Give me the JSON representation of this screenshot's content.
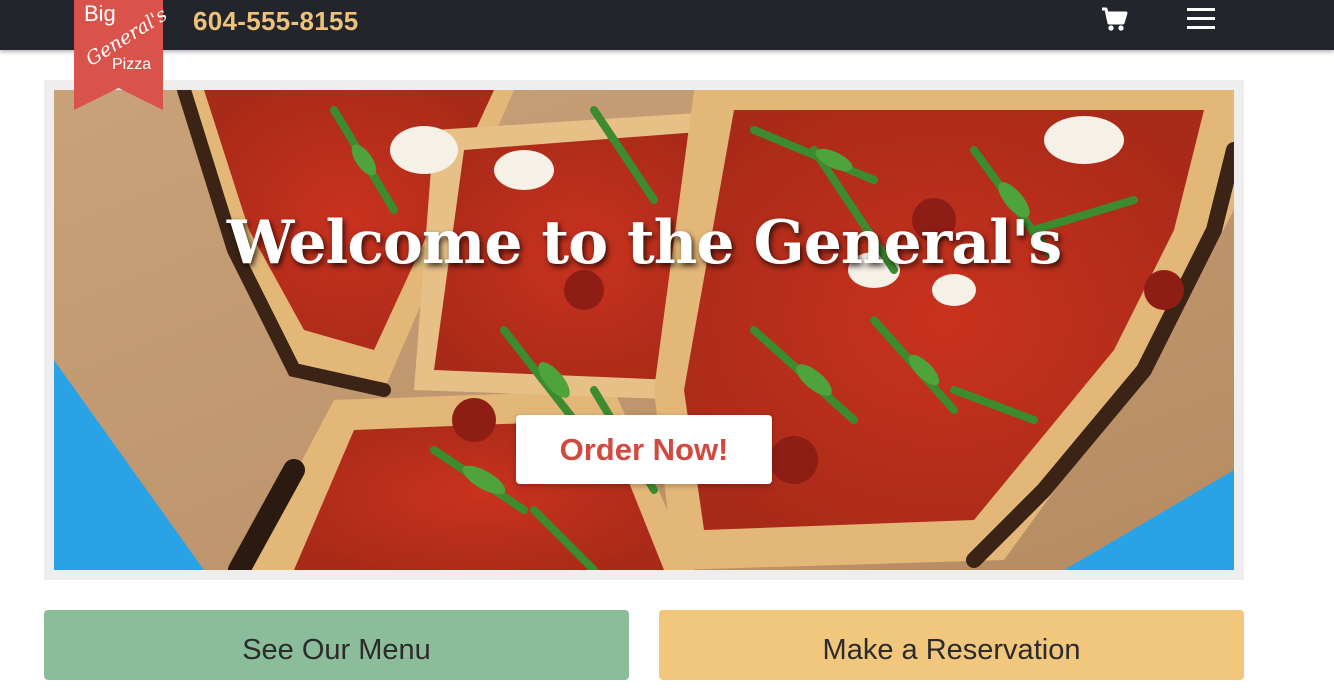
{
  "header": {
    "phone": "604-555-8155",
    "logo": {
      "line1": "Big",
      "line2": "General's",
      "line3": "Pizza"
    },
    "cart_icon": "shopping-cart-icon",
    "menu_icon": "hamburger-menu-icon"
  },
  "hero": {
    "title": "Welcome to the General's",
    "cta_label": "Order Now!"
  },
  "actions": {
    "menu_label": "See Our Menu",
    "reservation_label": "Make a Reservation"
  },
  "colors": {
    "header_bg": "#23252d",
    "phone": "#eec27a",
    "logo_red": "#d9534a",
    "order_text": "#d24a3f",
    "menu_bg": "#8bbd9b",
    "reservation_bg": "#f1c67d"
  }
}
